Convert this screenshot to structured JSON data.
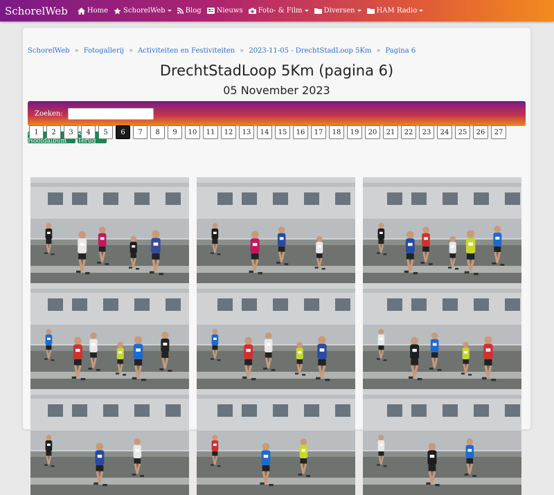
{
  "navbar": {
    "brand": "SchorelWeb",
    "items": [
      {
        "label": "Home",
        "icon": "home-icon",
        "dropdown": false
      },
      {
        "label": "SchorelWeb",
        "icon": "star-icon",
        "dropdown": true
      },
      {
        "label": "Blog",
        "icon": "rss-icon",
        "dropdown": false
      },
      {
        "label": "Nieuws",
        "icon": "newspaper-icon",
        "dropdown": false
      },
      {
        "label": "Foto- & Film",
        "icon": "camera-icon",
        "dropdown": true
      },
      {
        "label": "Diversen",
        "icon": "folder-icon",
        "dropdown": true
      },
      {
        "label": "HAM Radio",
        "icon": "folder-icon",
        "dropdown": true
      }
    ]
  },
  "breadcrumb": [
    "SchorelWeb",
    "Fotogallerij",
    "Activiteiten en Festiviteiten",
    "2023-11-05 - DrechtStadLoop 5Km",
    "Pagina 6"
  ],
  "page": {
    "title": "DrechtStadLoop 5Km (pagina 6)",
    "date": "05 November 2023"
  },
  "search": {
    "label": "Zoeken:",
    "value": ""
  },
  "buttons": {
    "main_album": "<<< Hoofdalbum",
    "back": "<< Terug"
  },
  "pagination": {
    "pages": [
      "1",
      "2",
      "3",
      "4",
      "5",
      "6",
      "7",
      "8",
      "9",
      "10",
      "11",
      "12",
      "13",
      "14",
      "15",
      "16",
      "17",
      "18",
      "19",
      "20",
      "21",
      "22",
      "23",
      "24",
      "25",
      "26",
      "27"
    ],
    "current": "6"
  },
  "colors": {
    "brand_gradient_start": "#7a1a86",
    "brand_gradient_end": "#f28c1c",
    "button_green": "#198754",
    "link_blue": "#2a6fd6"
  }
}
